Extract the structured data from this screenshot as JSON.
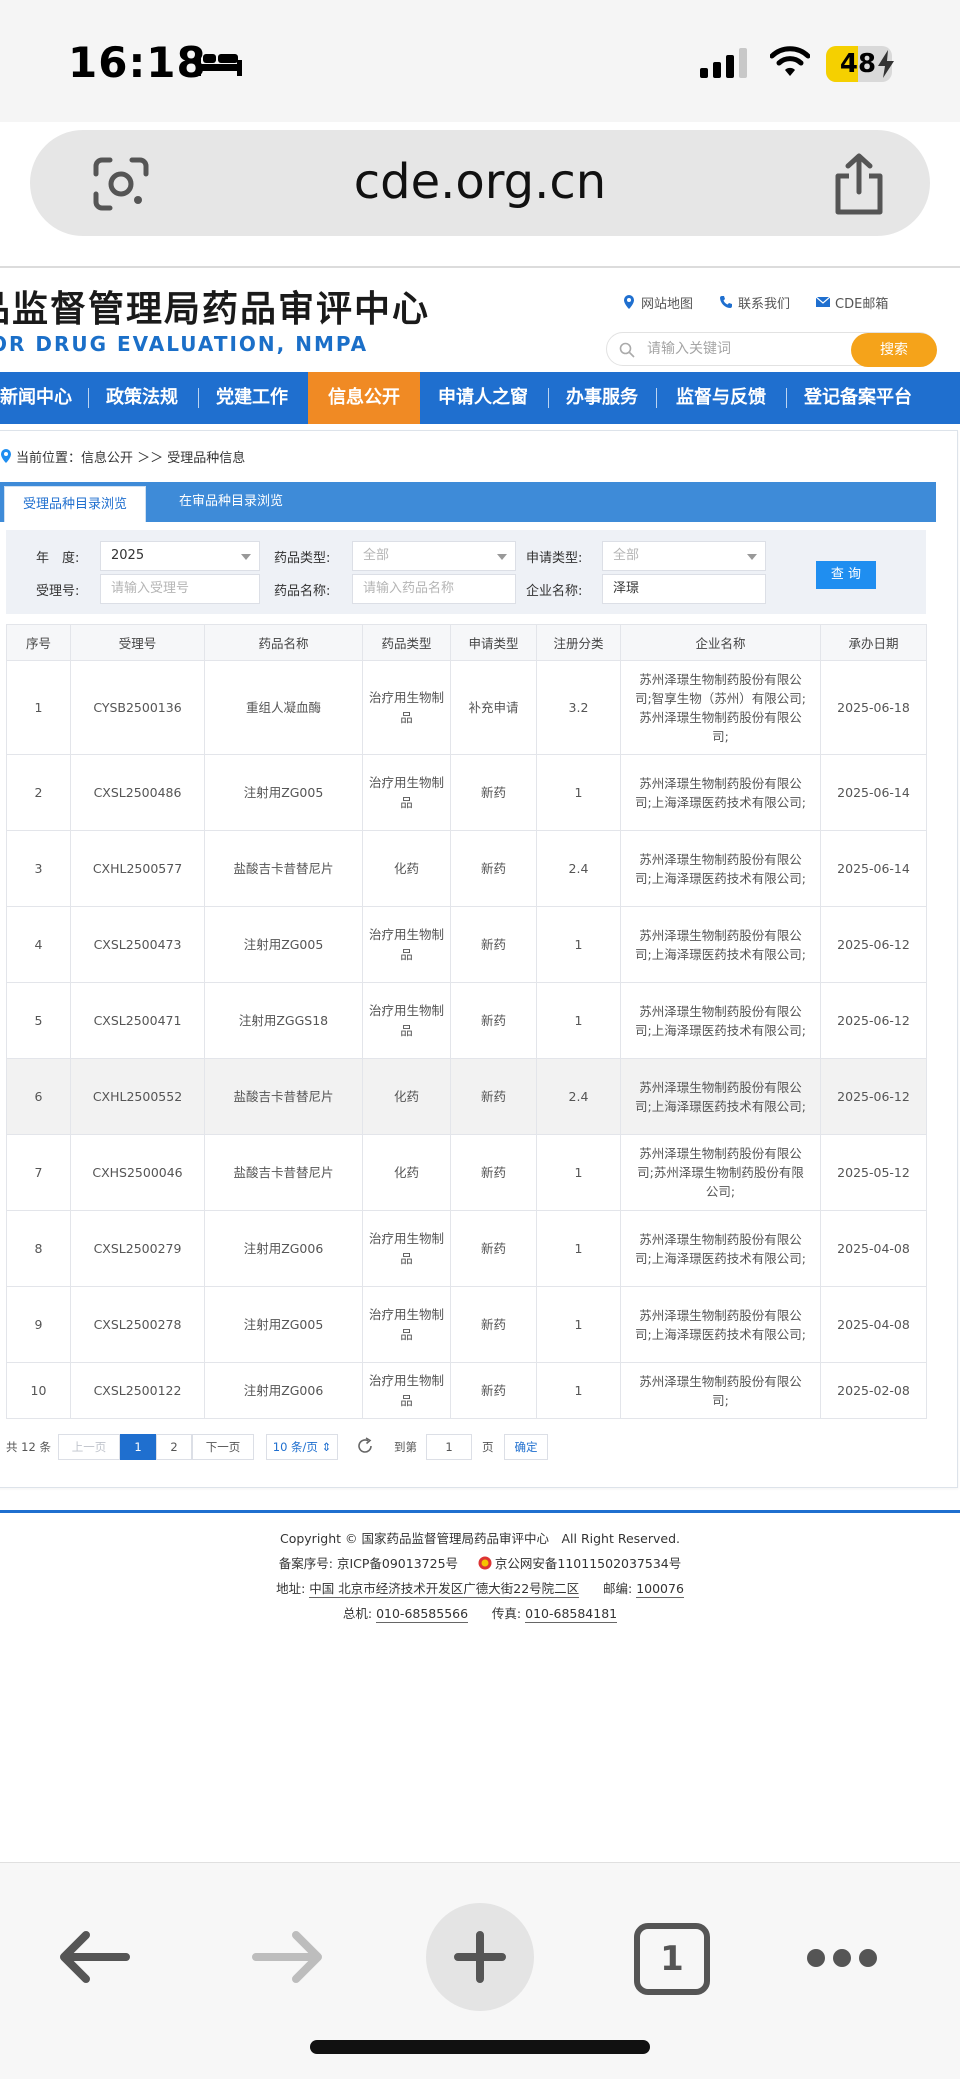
{
  "status_bar": {
    "time": "16:18",
    "battery_level": "48",
    "battery_percent": 48
  },
  "browser": {
    "url": "cde.org.cn"
  },
  "site": {
    "title": "品监督管理局药品审评中心",
    "subtitle": "OR DRUG EVALUATION, NMPA",
    "top_links": [
      "网站地图",
      "联系我们",
      "CDE邮箱"
    ],
    "search_placeholder": "请输入关键词",
    "search_button": "搜索"
  },
  "nav": {
    "items": [
      "新闻中心",
      "政策法规",
      "党建工作",
      "信息公开",
      "申请人之窗",
      "办事服务",
      "监督与反馈",
      "登记备案平台"
    ],
    "active": "信息公开"
  },
  "breadcrumb": {
    "text": "当前位置：信息公开 ＞＞ 受理品种信息"
  },
  "tabs": [
    "受理品种目录浏览",
    "在审品种目录浏览"
  ],
  "filters": {
    "year_label": "年　度:",
    "year_value": "2025",
    "drug_type_label": "药品类型:",
    "drug_type_value": "全部",
    "apply_type_label": "申请类型:",
    "apply_type_value": "全部",
    "accept_no_label": "受理号:",
    "accept_no_placeholder": "请输入受理号",
    "drug_name_label": "药品名称:",
    "drug_name_placeholder": "请输入药品名称",
    "company_label": "企业名称:",
    "company_value": "泽璟",
    "query_button": "查 询"
  },
  "table": {
    "headers": [
      "序号",
      "受理号",
      "药品名称",
      "药品类型",
      "申请类型",
      "注册分类",
      "企业名称",
      "承办日期"
    ],
    "rows": [
      [
        "1",
        "CYSB2500136",
        "重组人凝血酶",
        "治疗用生物制品",
        "补充申请",
        "3.2",
        "苏州泽璟生物制药股份有限公司;智享生物（苏州）有限公司;苏州泽璟生物制药股份有限公司;",
        "2025-06-18"
      ],
      [
        "2",
        "CXSL2500486",
        "注射用ZG005",
        "治疗用生物制品",
        "新药",
        "1",
        "苏州泽璟生物制药股份有限公司;上海泽璟医药技术有限公司;",
        "2025-06-14"
      ],
      [
        "3",
        "CXHL2500577",
        "盐酸吉卡昔替尼片",
        "化药",
        "新药",
        "2.4",
        "苏州泽璟生物制药股份有限公司;上海泽璟医药技术有限公司;",
        "2025-06-14"
      ],
      [
        "4",
        "CXSL2500473",
        "注射用ZG005",
        "治疗用生物制品",
        "新药",
        "1",
        "苏州泽璟生物制药股份有限公司;上海泽璟医药技术有限公司;",
        "2025-06-12"
      ],
      [
        "5",
        "CXSL2500471",
        "注射用ZGGS18",
        "治疗用生物制品",
        "新药",
        "1",
        "苏州泽璟生物制药股份有限公司;上海泽璟医药技术有限公司;",
        "2025-06-12"
      ],
      [
        "6",
        "CXHL2500552",
        "盐酸吉卡昔替尼片",
        "化药",
        "新药",
        "2.4",
        "苏州泽璟生物制药股份有限公司;上海泽璟医药技术有限公司;",
        "2025-06-12"
      ],
      [
        "7",
        "CXHS2500046",
        "盐酸吉卡昔替尼片",
        "化药",
        "新药",
        "1",
        "苏州泽璟生物制药股份有限公司;苏州泽璟生物制药股份有限公司;",
        "2025-05-12"
      ],
      [
        "8",
        "CXSL2500279",
        "注射用ZG006",
        "治疗用生物制品",
        "新药",
        "1",
        "苏州泽璟生物制药股份有限公司;上海泽璟医药技术有限公司;",
        "2025-04-08"
      ],
      [
        "9",
        "CXSL2500278",
        "注射用ZG005",
        "治疗用生物制品",
        "新药",
        "1",
        "苏州泽璟生物制药股份有限公司;上海泽璟医药技术有限公司;",
        "2025-04-08"
      ],
      [
        "10",
        "CXSL2500122",
        "注射用ZG006",
        "治疗用生物制品",
        "新药",
        "1",
        "苏州泽璟生物制药股份有限公司;",
        "2025-02-08"
      ]
    ]
  },
  "pagination": {
    "total": "共 12 条",
    "prev": "上一页",
    "pages": [
      "1",
      "2"
    ],
    "next": "下一页",
    "page_size": "10 条/页",
    "goto_label": "到第",
    "goto_value": "1",
    "page_unit": "页",
    "confirm": "确定"
  },
  "footer": {
    "copyright": "Copyright © 国家药品监督管理局药品审评中心　All Right Reserved.",
    "icp_label": "备案序号:",
    "icp": "京ICP备09013725号",
    "police": "京公网安备11011502037534号",
    "address_label": "地址:",
    "address": "中国 北京市经济技术开发区广德大街22号院二区",
    "postcode_label": "邮编:",
    "postcode": "100076",
    "phone_label": "总机:",
    "phone": "010-68585566",
    "fax_label": "传真:",
    "fax": "010-68584181"
  },
  "toolbar": {
    "tab_count": "1"
  }
}
